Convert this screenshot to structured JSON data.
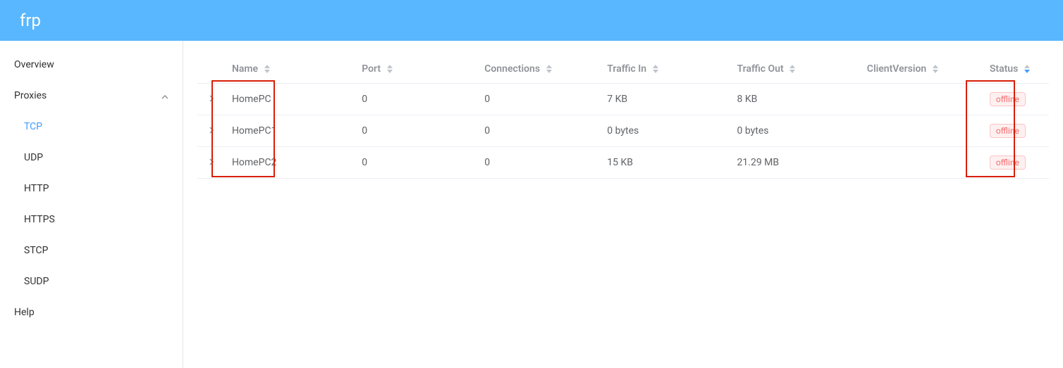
{
  "header": {
    "title": "frp"
  },
  "sidebar": {
    "overview": "Overview",
    "proxies": "Proxies",
    "proxies_items": {
      "tcp": "TCP",
      "udp": "UDP",
      "http": "HTTP",
      "https": "HTTPS",
      "stcp": "STCP",
      "sudp": "SUDP"
    },
    "help": "Help"
  },
  "table": {
    "headers": {
      "name": "Name",
      "port": "Port",
      "connections": "Connections",
      "traffic_in": "Traffic In",
      "traffic_out": "Traffic Out",
      "client_version": "ClientVersion",
      "status": "Status"
    },
    "rows": [
      {
        "name": "HomePC",
        "port": "0",
        "connections": "0",
        "traffic_in": "7 KB",
        "traffic_out": "8 KB",
        "client_version": "",
        "status": "offline"
      },
      {
        "name": "HomePC1",
        "port": "0",
        "connections": "0",
        "traffic_in": "0 bytes",
        "traffic_out": "0 bytes",
        "client_version": "",
        "status": "offline"
      },
      {
        "name": "HomePC2",
        "port": "0",
        "connections": "0",
        "traffic_in": "15 KB",
        "traffic_out": "21.29 MB",
        "client_version": "",
        "status": "offline"
      }
    ]
  }
}
